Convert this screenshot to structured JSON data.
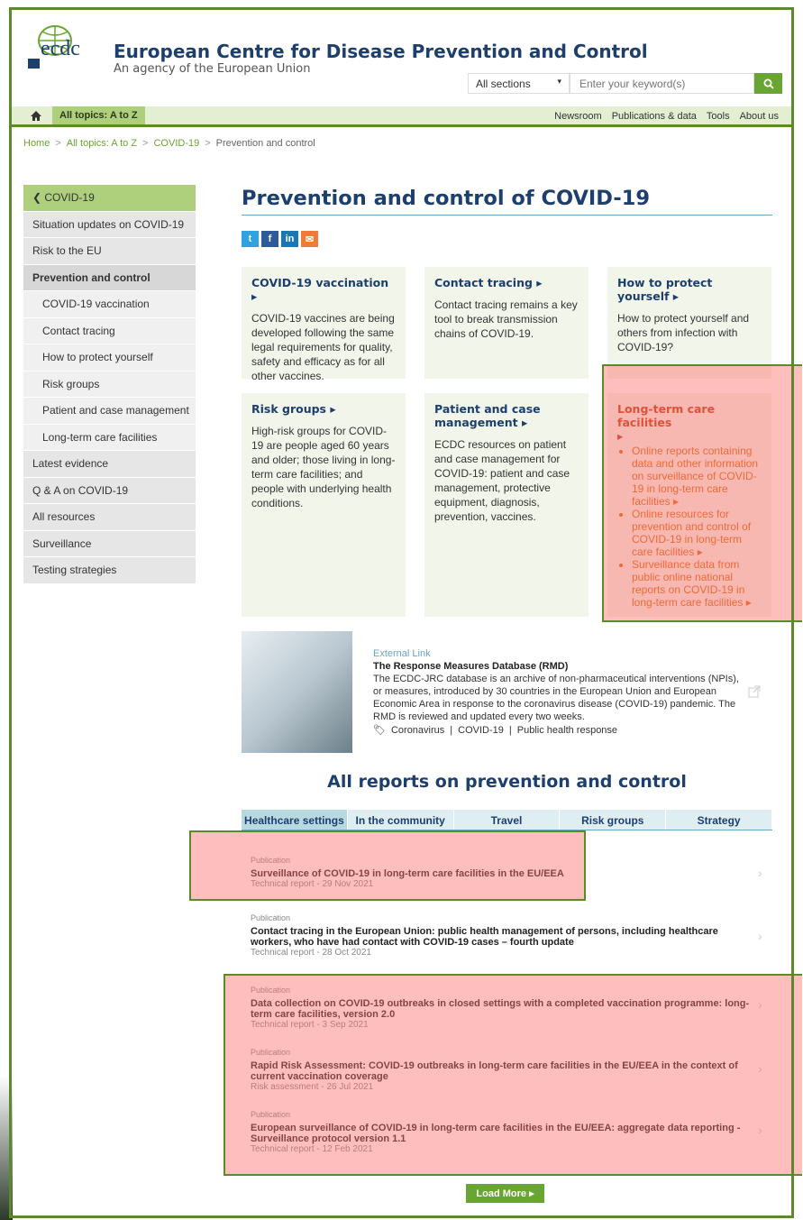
{
  "header": {
    "site_title": "European Centre for Disease Prevention and Control",
    "site_subtitle": "An agency of the European Union",
    "logo_text": "ecdc",
    "sections_select": "All sections",
    "search_placeholder": "Enter your keyword(s)"
  },
  "nav": {
    "topics": "All topics: A to Z",
    "right_items": [
      "Newsroom",
      "Publications & data",
      "Tools",
      "About us"
    ]
  },
  "breadcrumb": [
    "Home",
    "All topics: A to Z",
    "COVID-19",
    "Prevention and control"
  ],
  "sidebar": {
    "back": "COVID-19",
    "items": [
      "Situation updates on COVID-19",
      "Risk to the EU",
      "Prevention and control",
      "COVID-19 vaccination",
      "Contact tracing",
      "How to protect yourself",
      "Risk groups",
      "Patient and case management",
      "Long-term care facilities",
      "Latest evidence",
      "Q & A on COVID-19",
      "All resources",
      "Surveillance",
      "Testing strategies"
    ]
  },
  "main": {
    "page_title": "Prevention and control of COVID-19",
    "cards": [
      {
        "title": "COVID-19 vaccination ▸",
        "text": "COVID-19 vaccines are being developed following the same legal requirements for quality, safety and efficacy as for all other vaccines."
      },
      {
        "title": "Contact tracing ▸",
        "text": "Contact tracing remains a key tool to break transmission chains of COVID-19."
      },
      {
        "title": "How to protect yourself ▸",
        "text": "How to protect yourself and others from infection with COVID-19?"
      },
      {
        "title": "Risk groups ▸",
        "text": "High-risk groups for COVID-19 are people aged 60 years and older; those living in long-term care facilities; and people with underlying health conditions."
      },
      {
        "title": "Patient and case management ▸",
        "text": "ECDC resources on patient and case management for COVID-19: patient and case management, protective equipment, diagnosis, prevention, vaccines."
      },
      {
        "title": "Long-term care facilities",
        "title_arrow": "▸",
        "bullets": [
          "Online reports containing data and other information on surveillance of COVID-19 in long-term care facilities ▸",
          "Online resources for prevention and control of COVID-19 in long-term care facilities ▸",
          "Surveillance data from public online national reports on COVID-19 in long-term care facilities ▸"
        ]
      }
    ],
    "external": {
      "label": "External Link",
      "title": "The Response Measures Database (RMD)",
      "text": "The ECDC-JRC database is an archive of non-pharmaceutical interventions (NPIs), or measures, introduced by 30 countries in the European Union and European Economic Area in response to the coronavirus disease (COVID-19) pandemic. The RMD is reviewed and updated every two weeks.",
      "tags": [
        "Coronavirus",
        "|",
        "COVID-19",
        "|",
        "Public health response"
      ]
    },
    "reports_heading": "All reports on prevention and control",
    "tabs": [
      "Healthcare settings",
      "In the community",
      "Travel",
      "Risk groups",
      "Strategy"
    ],
    "reports": [
      {
        "kind": "Publication",
        "title": "Surveillance of COVID-19 in long-term care facilities in the EU/EEA",
        "meta": "Technical report - 29 Nov 2021"
      },
      {
        "kind": "Publication",
        "title": "Contact tracing in the European Union: public health management of persons, including healthcare workers, who have had contact with COVID-19 cases – fourth update",
        "meta": "Technical report - 28 Oct 2021"
      },
      {
        "kind": "Publication",
        "title": "Data collection on COVID-19 outbreaks in closed settings with a completed vaccination programme: long-term care facilities, version 2.0",
        "meta": "Technical report - 3 Sep 2021"
      },
      {
        "kind": "Publication",
        "title": "Rapid Risk Assessment: COVID-19 outbreaks in long-term care facilities in the EU/EEA in the context of current vaccination coverage",
        "meta": "Risk assessment - 26 Jul 2021"
      },
      {
        "kind": "Publication",
        "title": "European surveillance of COVID-19 in long-term care facilities in the EU/EEA: aggregate data reporting - Surveillance protocol version 1.1",
        "meta": "Technical report - 12 Feb 2021"
      }
    ],
    "load_more": "Load More"
  },
  "colors": {
    "brand_green": "#69a532",
    "brand_blue": "#1d3f6e",
    "highlight": "#ff6e6e"
  }
}
